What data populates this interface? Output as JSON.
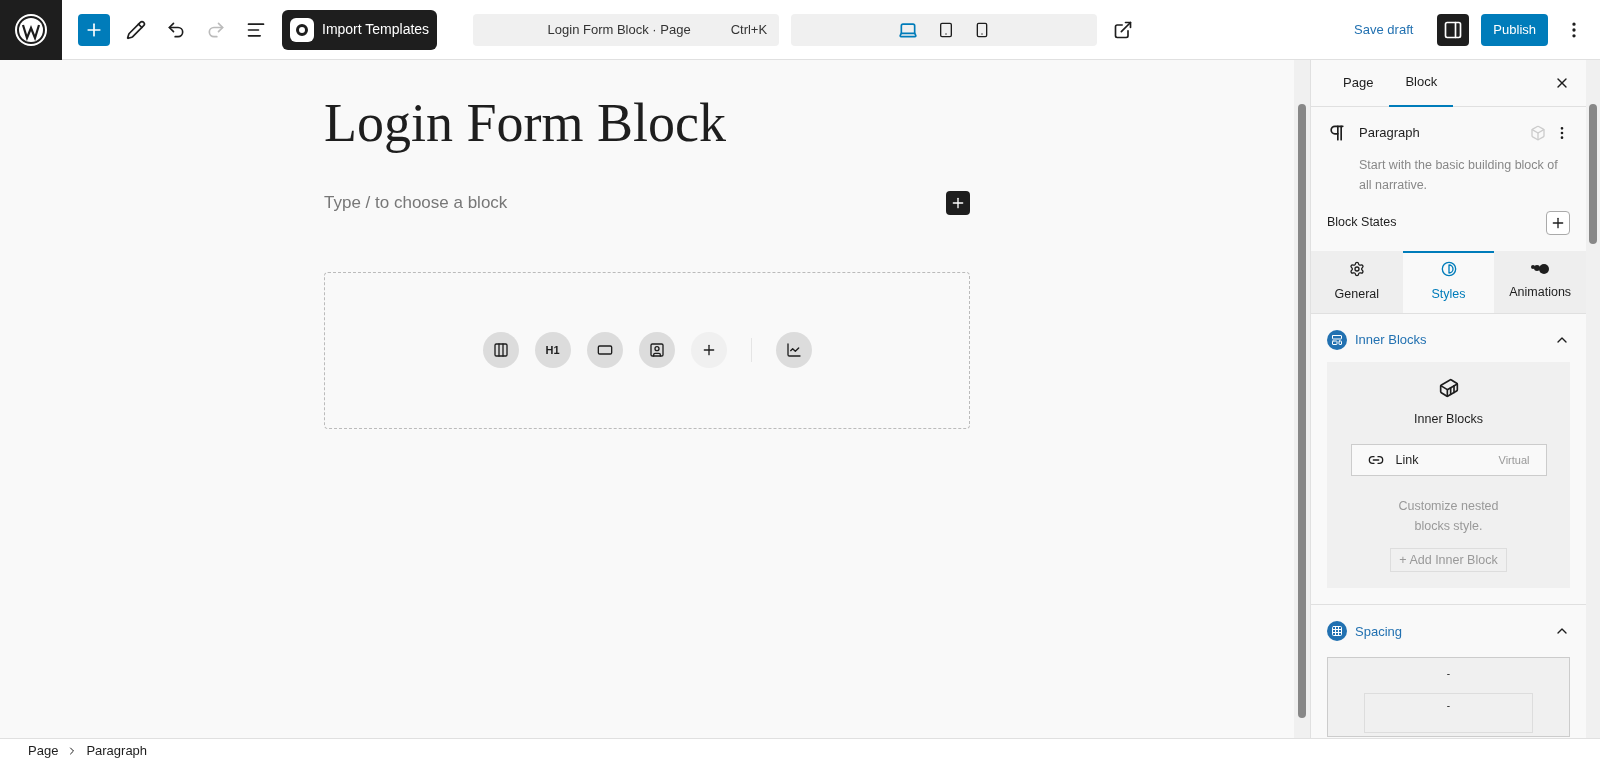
{
  "toolbar": {
    "import_button": "Import Templates",
    "document_title": "Login Form Block · Page",
    "shortcut": "Ctrl+K",
    "devices": [
      {
        "kind": "desktop",
        "selected": true
      },
      {
        "kind": "tablet",
        "selected": false
      },
      {
        "kind": "mobile",
        "selected": false
      }
    ],
    "save_draft": "Save draft",
    "settings_open": true,
    "publish": "Publish"
  },
  "canvas": {
    "title": "Login Form Block",
    "placeholder": "Type / to choose a block",
    "pattern_buttons": [
      {
        "kind": "columns"
      },
      {
        "kind": "heading",
        "label": "H1"
      },
      {
        "kind": "button"
      },
      {
        "kind": "form"
      },
      {
        "kind": "add"
      },
      {
        "kind": "chart"
      }
    ]
  },
  "sidebar": {
    "tabs": [
      {
        "label": "Page",
        "selected": false
      },
      {
        "label": "Block",
        "selected": true
      }
    ],
    "block": {
      "name": "Paragraph",
      "description": "Start with the basic building block of all narrative."
    },
    "block_states": "Block States",
    "sub_tabs": [
      {
        "kind": "general",
        "label": "General",
        "selected": false
      },
      {
        "kind": "styles",
        "label": "Styles",
        "selected": true
      },
      {
        "kind": "animations",
        "label": "Animations",
        "selected": false
      }
    ],
    "inner_blocks": {
      "title": "Inner Blocks",
      "expanded": true,
      "card_title": "Inner Blocks",
      "item": {
        "label": "Link",
        "badge": "Virtual"
      },
      "hint": "Customize nested blocks style.",
      "add_button": "+ Add Inner Block"
    },
    "spacing": {
      "title": "Spacing",
      "expanded": true,
      "values": [
        "-",
        "-"
      ]
    }
  },
  "breadcrumb": [
    "Page",
    "Paragraph"
  ]
}
